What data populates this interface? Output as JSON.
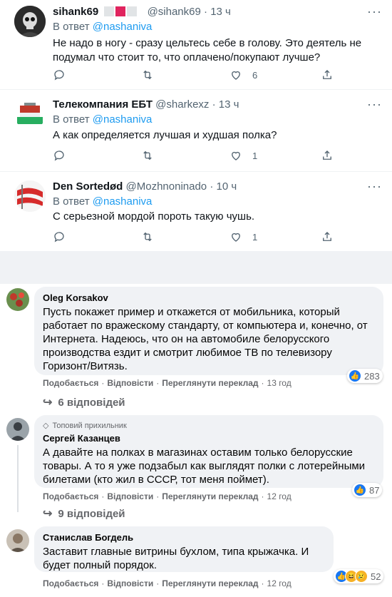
{
  "tweets": [
    {
      "name": "sihank69",
      "handle": "@sihank69",
      "time": "13 ч",
      "reply_prefix": "В ответ",
      "reply_to": "@nashaniva",
      "text": "Не надо в ногу - сразу цельтесь себе в голову. Это деятель не подумал что стоит то, что оплачено/покупают лучше?",
      "likes": "6"
    },
    {
      "name": "Телекомпания ЕБТ",
      "handle": "@sharkexz",
      "time": "13 ч",
      "reply_prefix": "В ответ",
      "reply_to": "@nashaniva",
      "text": "А как определяется лучшая и худшая полка?",
      "likes": "1"
    },
    {
      "name": "Den Sortedød",
      "handle": "@Mozhnoninado",
      "time": "10 ч",
      "reply_prefix": "В ответ",
      "reply_to": "@nashaniva",
      "text": "С серьезной мордой пороть такую чушь.",
      "likes": "1"
    }
  ],
  "tweet_separator": "·",
  "more_glyph": "···",
  "colors": {
    "twitter_link": "#1d9bf0",
    "twitter_muted": "#536471",
    "fb_bubble": "#f0f2f5",
    "fb_muted": "#65676b",
    "like_blue": "#1877f2",
    "love_red": "#f33e58",
    "haha_yellow": "#f7b125"
  },
  "fb_actions": {
    "like": "Подобається",
    "reply": "Відповісти",
    "translate": "Переглянути переклад",
    "dot": "·"
  },
  "fb_comments": [
    {
      "name": "Oleg Korsakov",
      "text": "Пусть покажет пример и откажется от мобильника, который работает по вражескому стандарту, от компьютера и, конечно, от Интернета. Надеюсь, что он на автомобиле белорусского производства ездит и смотрит любимое ТВ по телевизору Горизонт/Витязь.",
      "reactions": "283",
      "time": "13 год",
      "replies": "6 відповідей"
    },
    {
      "badge": "Топовий прихильник",
      "name": "Сергей Казанцев",
      "text": "А давайте на полках в магазинах оставим только белорусские товары. А то я уже подзабыл как выглядят полки с лотерейными билетами (кто жил в СССР, тот меня поймет).",
      "reactions": "87",
      "time": "12 год",
      "replies": "9 відповідей"
    },
    {
      "name": "Станислав Богдель",
      "text": "Заставит главные витрины бухлом, типа крыжачка. И будет полный порядок.",
      "reactions": "52",
      "time": "12 год"
    }
  ]
}
